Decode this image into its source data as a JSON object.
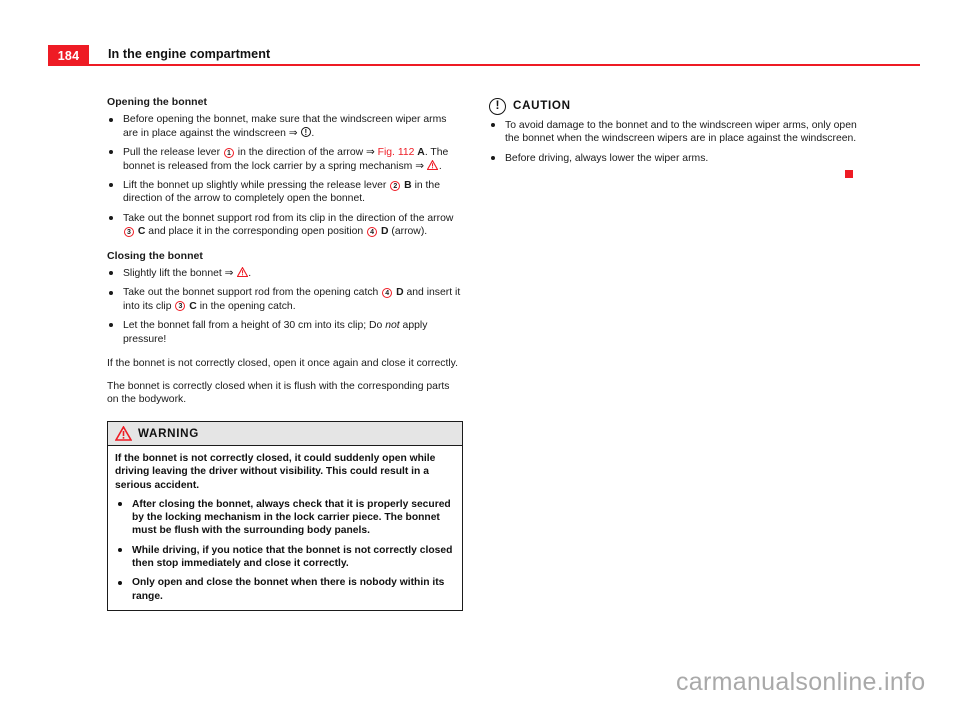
{
  "header": {
    "page_number": "184",
    "title": "In the engine compartment",
    "accent_color": "#ee1b24"
  },
  "left_column": {
    "section_opening": {
      "heading": "Opening the bonnet",
      "bullets": [
        {
          "parts": [
            {
              "t": "Before opening the bonnet, make sure that the windscreen wiper arms are in place against the windscreen ⇒ "
            },
            {
              "t": "caution-ref",
              "type": "caution-circle"
            },
            {
              "t": "."
            }
          ]
        },
        {
          "parts": [
            {
              "t": "Pull the release lever "
            },
            {
              "t": "1",
              "type": "circled-number"
            },
            {
              "t": " in the direction of the arrow ⇒ "
            },
            {
              "t": "Fig. 112",
              "type": "red"
            },
            {
              "t": " "
            },
            {
              "t": "A",
              "type": "bold"
            },
            {
              "t": ". The bonnet is released from the lock carrier by a spring mechanism ⇒ "
            },
            {
              "t": "warning-ref",
              "type": "warning-triangle"
            },
            {
              "t": "."
            }
          ]
        },
        {
          "parts": [
            {
              "t": "Lift the bonnet up slightly while pressing the release lever "
            },
            {
              "t": "2",
              "type": "circled-number"
            },
            {
              "t": " "
            },
            {
              "t": "B",
              "type": "bold"
            },
            {
              "t": " in the direction of the arrow to completely open the bonnet."
            }
          ]
        },
        {
          "parts": [
            {
              "t": "Take out the bonnet support rod from its clip in the direction of the arrow "
            },
            {
              "t": "3",
              "type": "circled-number"
            },
            {
              "t": " "
            },
            {
              "t": "C",
              "type": "bold"
            },
            {
              "t": " and place it in the corresponding open position "
            },
            {
              "t": "4",
              "type": "circled-number"
            },
            {
              "t": " "
            },
            {
              "t": "D",
              "type": "bold"
            },
            {
              "t": " (arrow)."
            }
          ]
        }
      ]
    },
    "section_closing": {
      "heading": "Closing the bonnet",
      "bullets": [
        {
          "parts": [
            {
              "t": "Slightly lift the bonnet ⇒ "
            },
            {
              "t": "warning-ref",
              "type": "warning-triangle"
            },
            {
              "t": "."
            }
          ]
        },
        {
          "parts": [
            {
              "t": "Take out the bonnet support rod from the opening catch "
            },
            {
              "t": "4",
              "type": "circled-number"
            },
            {
              "t": " "
            },
            {
              "t": "D",
              "type": "bold"
            },
            {
              "t": " and insert it into its clip "
            },
            {
              "t": "3",
              "type": "circled-number"
            },
            {
              "t": " "
            },
            {
              "t": "C",
              "type": "bold"
            },
            {
              "t": " in the opening catch."
            }
          ]
        },
        {
          "parts": [
            {
              "t": "Let the bonnet fall from a height of 30 cm into its clip; Do "
            },
            {
              "t": "not",
              "type": "italic"
            },
            {
              "t": " apply pressure!"
            }
          ]
        }
      ],
      "paragraphs": [
        "If the bonnet is not correctly closed, open it once again and close it correctly.",
        "The bonnet is correctly closed when it is flush with the corresponding parts on the bodywork."
      ]
    },
    "warning_box": {
      "icon": "warning-triangle-icon",
      "title": "WARNING",
      "intro": "If the bonnet is not correctly closed, it could suddenly open while driving leaving the driver without visibility. This could result in a serious accident.",
      "bullets": [
        "After closing the bonnet, always check that it is properly secured by the locking mechanism in the lock carrier piece. The bonnet must be flush with the surrounding body panels.",
        "While driving, if you notice that the bonnet is not correctly closed then stop immediately and close it correctly.",
        "Only open and close the bonnet when there is nobody within its range."
      ],
      "header_bg": "#e5e5e5",
      "border_color": "#1b1b1b"
    }
  },
  "right_column": {
    "caution_box": {
      "icon": "caution-circle-exclamation-icon",
      "title": "CAUTION",
      "bullets": [
        "To avoid damage to the bonnet and to the windscreen wiper arms, only open the bonnet when the windscreen wipers are in place against the windscreen.",
        "Before driving, always lower the wiper arms."
      ]
    },
    "section_end_marker_color": "#ee1b24"
  },
  "watermark": {
    "text": "carmanualsonline.info",
    "color": "#a9a9a9"
  }
}
